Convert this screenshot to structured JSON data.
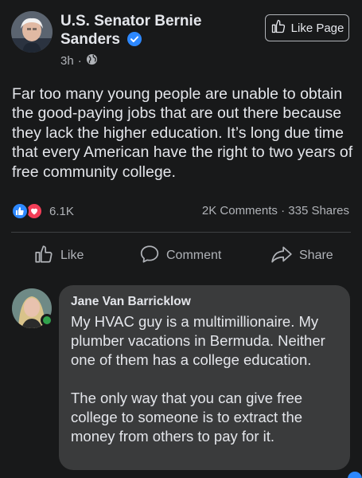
{
  "post": {
    "author": "U.S. Senator Bernie Sanders",
    "time": "3h",
    "like_page_label": "Like Page",
    "text": "Far too many young people are unable to obtain the good-paying jobs that are out there because they lack the higher education. It’s long due time that every American have the right to two years of free community college.",
    "reaction_count": "6.1K",
    "comments_count": "2K Comments",
    "shares_count": "335 Shares"
  },
  "actions": {
    "like": "Like",
    "comment": "Comment",
    "share": "Share"
  },
  "comment": {
    "author": "Jane Van Barricklow",
    "text": "My HVAC guy is a multimillionaire. My plumber vacations in Bermuda. Neither one of them has a college education.\n\nThe only way that you can give free college to someone is to extract the money from others to pay for it."
  },
  "colors": {
    "background": "#18191a",
    "bubble": "#3a3b3c",
    "accent": "#2d88ff",
    "love": "#f33e58",
    "online": "#31a24c"
  },
  "icons": [
    "verified-badge-icon",
    "globe-icon",
    "thumbs-up-icon",
    "heart-icon",
    "comment-icon",
    "share-icon"
  ]
}
